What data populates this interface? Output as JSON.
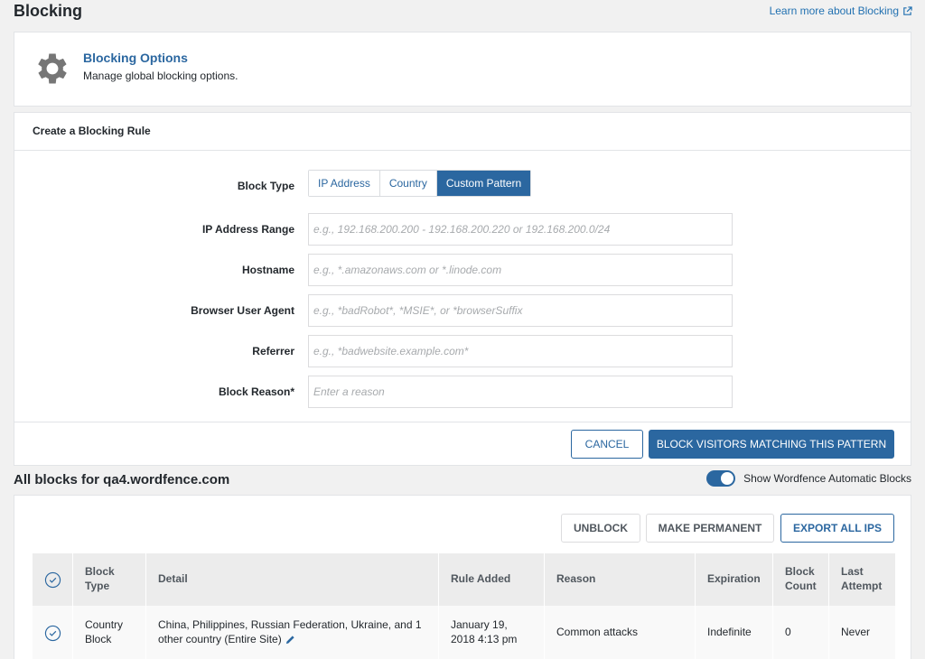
{
  "page": {
    "title": "Blocking",
    "learn_more": "Learn more about Blocking"
  },
  "options": {
    "title": "Blocking Options",
    "subtitle": "Manage global blocking options."
  },
  "rule": {
    "header": "Create a Blocking Rule",
    "block_type_label": "Block Type",
    "block_types": [
      "IP Address",
      "Country",
      "Custom Pattern"
    ],
    "active_type": "Custom Pattern",
    "fields": [
      {
        "label": "IP Address Range",
        "placeholder": "e.g., 192.168.200.200 - 192.168.200.220 or 192.168.200.0/24"
      },
      {
        "label": "Hostname",
        "placeholder": "e.g., *.amazonaws.com or *.linode.com"
      },
      {
        "label": "Browser User Agent",
        "placeholder": "e.g., *badRobot*, *MSIE*, or *browserSuffix"
      },
      {
        "label": "Referrer",
        "placeholder": "e.g., *badwebsite.example.com*"
      },
      {
        "label": "Block Reason*",
        "placeholder": "Enter a reason"
      }
    ],
    "cancel": "Cancel",
    "submit": "Block Visitors Matching This Pattern"
  },
  "blocks": {
    "title": "All blocks for qa4.wordfence.com",
    "toggle_label": "Show Wordfence Automatic Blocks",
    "toggle_on": true,
    "unblock": "Unblock",
    "make_permanent": "Make Permanent",
    "export": "Export All IPs",
    "columns": [
      "Block Type",
      "Detail",
      "Rule Added",
      "Reason",
      "Expiration",
      "Block Count",
      "Last Attempt"
    ],
    "rows": [
      {
        "type": "Country Block",
        "detail": "China, Philippines, Russian Federation, Ukraine, and 1 other country (Entire Site)",
        "added": "January 19, 2018 4:13 pm",
        "reason": "Common attacks",
        "expiration": "Indefinite",
        "count": "0",
        "last": "Never"
      }
    ]
  },
  "colors": {
    "primary": "#2b67a0",
    "gear": "#767676"
  }
}
